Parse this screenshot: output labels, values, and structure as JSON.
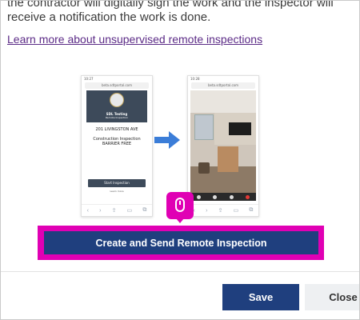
{
  "intro": {
    "line1": "the contractor will digitally sign the work and the inspector will",
    "line2": "receive a notification the work is done."
  },
  "learn_more_link": "Learn more about unsupervised remote inspections",
  "phone_left": {
    "status_time": "10:27",
    "url": "beta.sdtportal.com",
    "header_title": "SDL Testing",
    "header_subtitle": "Remote Inspection",
    "address": "201 LIVINGSTON AVE",
    "inspection_line1": "Construction Inspection",
    "inspection_line2": "BARRIER FREE",
    "start_button": "Start Inspection",
    "learn_more": "Learn more"
  },
  "phone_right": {
    "status_time": "10:28",
    "url": "beta.sdtportal.com"
  },
  "icons": {
    "arrow": "arrow-right-icon",
    "cursor": "mouse-icon"
  },
  "colors": {
    "primary": "#1f3f7e",
    "highlight": "#e000b4",
    "link": "#5b2a86"
  },
  "buttons": {
    "create": "Create and Send Remote Inspection",
    "save": "Save",
    "close": "Close"
  }
}
